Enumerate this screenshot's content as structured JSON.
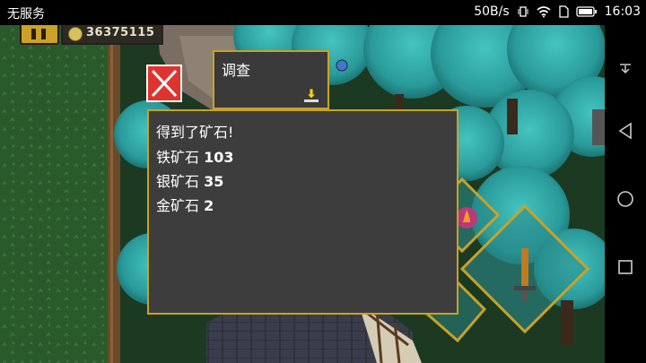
{
  "status_bar": {
    "carrier": "无服务",
    "speed": "50B/s",
    "time": "16:03"
  },
  "hud": {
    "coins": "36375115"
  },
  "investigate": {
    "label": "调查"
  },
  "dialog": {
    "title": "得到了矿石!",
    "ores": [
      {
        "name": "铁矿石",
        "amount": "103"
      },
      {
        "name": "银矿石",
        "amount": "35"
      },
      {
        "name": "金矿石",
        "amount": "2"
      }
    ]
  },
  "colors": {
    "accent": "#c9a227",
    "close": "#e0332f",
    "panel": "#3d3d3d",
    "foliage": "#2ea0a0",
    "grass": "#2a5a2c"
  },
  "icons": [
    "pause-icon",
    "coin-icon",
    "close-icon",
    "download-icon",
    "sword-icon",
    "fire-icon",
    "wifi-icon",
    "battery-icon",
    "back-icon",
    "home-icon",
    "recents-icon"
  ]
}
